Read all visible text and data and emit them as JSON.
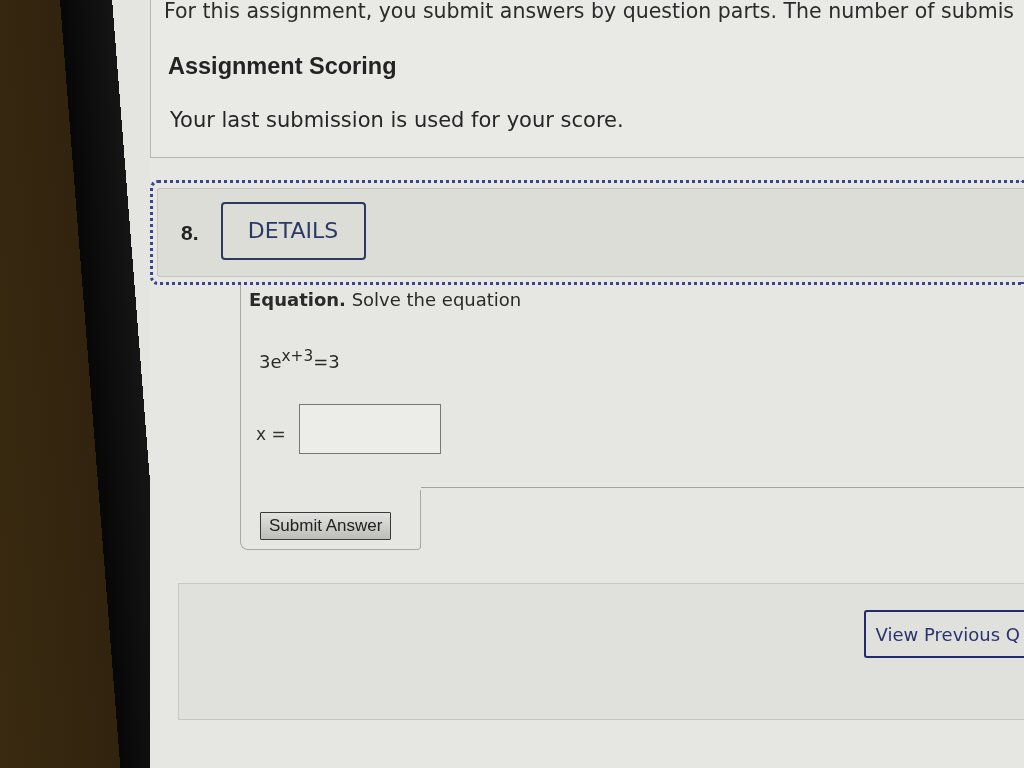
{
  "assignment_info": {
    "intro": "For this assignment, you submit answers by question parts. The number of submis",
    "heading": "Assignment Scoring",
    "text": "Your last submission is used for your score."
  },
  "question": {
    "number": "8.",
    "details_button": "DETAILS",
    "prompt": "**Equation.** Solve the equation",
    "equation": "3e$^{x+3}$=3",
    "answer": {
      "label": "x ="
    },
    "submit_button": "Submit Answer"
  },
  "navigation": {
    "view_previous_button": "View Previous Q"
  }
}
